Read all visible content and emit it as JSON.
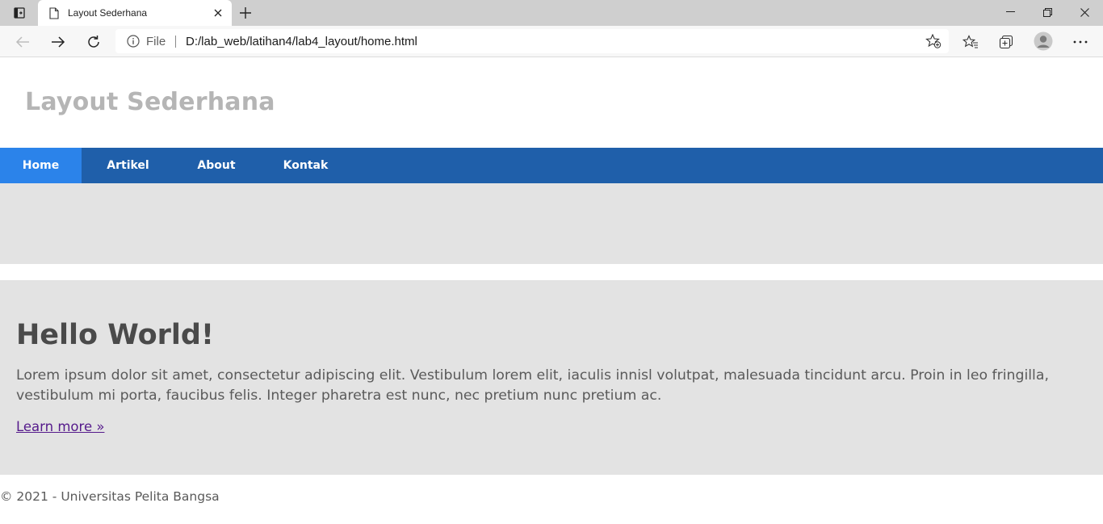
{
  "browser": {
    "tab": {
      "title": "Layout Sederhana"
    },
    "address_bar": {
      "scheme_label": "File",
      "url": "D:/lab_web/latihan4/lab4_layout/home.html"
    },
    "icons": [
      "tab-actions-icon",
      "document-icon",
      "close-icon",
      "plus-icon",
      "minimize-icon",
      "restore-icon",
      "window-close-icon",
      "back-icon",
      "forward-icon",
      "refresh-icon",
      "info-icon",
      "add-favorite-icon",
      "favorites-icon",
      "collections-icon",
      "profile-icon",
      "more-icon"
    ]
  },
  "site": {
    "title": "Layout Sederhana",
    "nav": [
      {
        "label": "Home",
        "active": true
      },
      {
        "label": "Artikel",
        "active": false
      },
      {
        "label": "About",
        "active": false
      },
      {
        "label": "Kontak",
        "active": false
      }
    ],
    "main": {
      "heading": "Hello World!",
      "paragraph": "Lorem ipsum dolor sit amet, consectetur adipiscing elit. Vestibulum lorem elit, iaculis innisl volutpat, malesuada tincidunt arcu. Proin in leo fringilla, vestibulum mi porta, faucibus felis. Integer pharetra est nunc, nec pretium nunc pretium ac.",
      "link": "Learn more »"
    },
    "footer": "© 2021 - Universitas Pelita Bangsa"
  },
  "colors": {
    "nav_bar": "#1f5faa",
    "nav_active": "#2b83ea",
    "panel_bg": "#e3e3e3",
    "site_title": "#b5b5b5",
    "visited_link": "#551a8b"
  }
}
